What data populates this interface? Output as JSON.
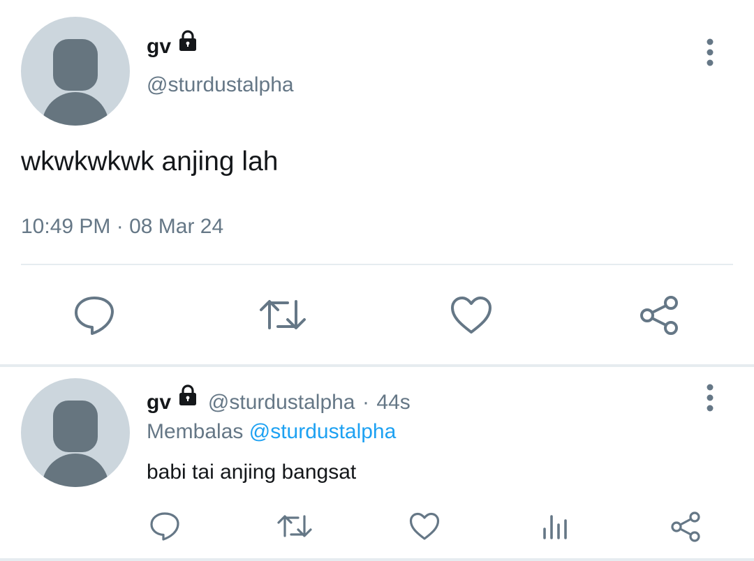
{
  "tweet": {
    "display_name": "gv",
    "handle": "@sturdustalpha",
    "text": "wkwkwkwk anjing lah",
    "timestamp": "10:49 PM · 08 Mar 24",
    "icons": {
      "lock": "lock-icon",
      "more": "more-vertical-icon",
      "reply": "reply-icon",
      "retweet": "retweet-icon",
      "like": "heart-icon",
      "share": "share-icon"
    }
  },
  "reply": {
    "display_name": "gv",
    "handle": "@sturdustalpha",
    "separator": "·",
    "time_ago": "44s",
    "replying_label": "Membalas",
    "replying_to": "@sturdustalpha",
    "text": "babi tai anjing bangsat",
    "icons": {
      "lock": "lock-icon",
      "more": "more-vertical-icon",
      "reply": "reply-icon",
      "retweet": "retweet-icon",
      "like": "heart-icon",
      "analytics": "analytics-icon",
      "share": "share-icon"
    }
  },
  "colors": {
    "text_primary": "#14171a",
    "text_secondary": "#657786",
    "link": "#1da1f2",
    "avatar_bg": "#ccd6dd",
    "avatar_fg": "#66757f",
    "divider": "#e6ecf0"
  }
}
